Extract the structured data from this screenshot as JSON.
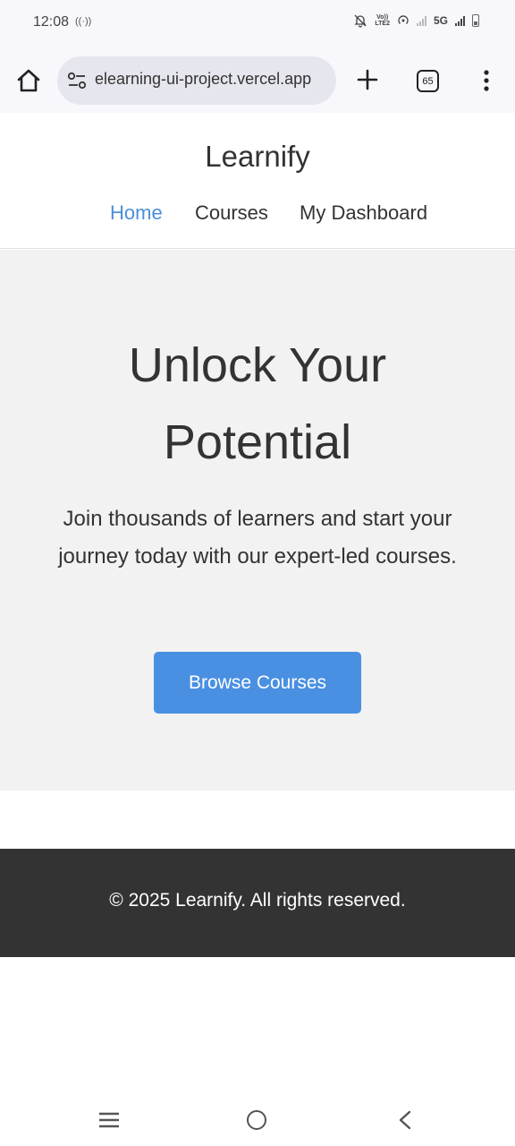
{
  "status_bar": {
    "time": "12:08",
    "left_indicator": "((·))",
    "volte_top": "Vo))",
    "volte_bottom": "LTE2",
    "network": "5G"
  },
  "browser": {
    "url": "elearning-ui-project.vercel.app",
    "tab_count": "65"
  },
  "site": {
    "brand": "Learnify",
    "nav": [
      {
        "label": "Home",
        "active": true
      },
      {
        "label": "Courses",
        "active": false
      },
      {
        "label": "My Dashboard",
        "active": false
      }
    ]
  },
  "hero": {
    "title": "Unlock Your Potential",
    "subtitle": "Join thousands of learners and start your journey today with our expert-led courses.",
    "cta_label": "Browse Courses"
  },
  "footer": {
    "text": "© 2025 Learnify. All rights reserved."
  },
  "colors": {
    "accent": "#4a90e2",
    "nav_active": "#4a90d9",
    "hero_bg": "#f2f2f2",
    "footer_bg": "#333333"
  }
}
